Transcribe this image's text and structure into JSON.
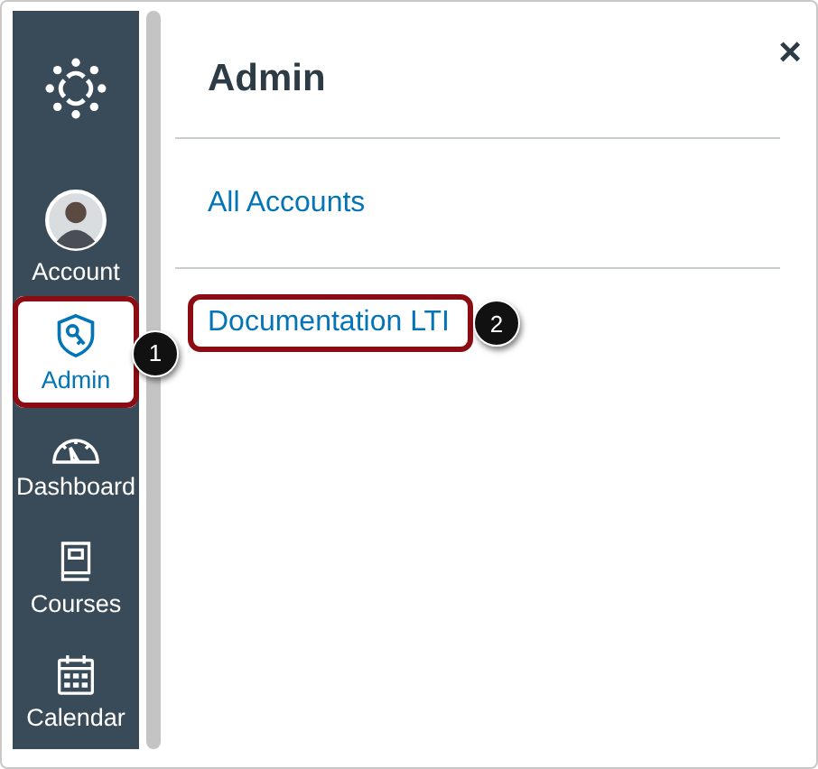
{
  "nav": [
    {
      "kind": "account",
      "label": "Account",
      "selected": false,
      "highlighted": false
    },
    {
      "kind": "admin",
      "label": "Admin",
      "selected": true,
      "highlighted": true,
      "callout": "1"
    },
    {
      "kind": "dashboard",
      "label": "Dashboard",
      "selected": false,
      "highlighted": false
    },
    {
      "kind": "courses",
      "label": "Courses",
      "selected": false,
      "highlighted": false
    },
    {
      "kind": "calendar",
      "label": "Calendar",
      "selected": false,
      "highlighted": false
    }
  ],
  "panel": {
    "title": "Admin",
    "close": "×",
    "links": [
      {
        "label": "All Accounts",
        "highlighted": false
      },
      {
        "label": "Documentation LTI",
        "highlighted": true,
        "callout": "2"
      }
    ]
  }
}
